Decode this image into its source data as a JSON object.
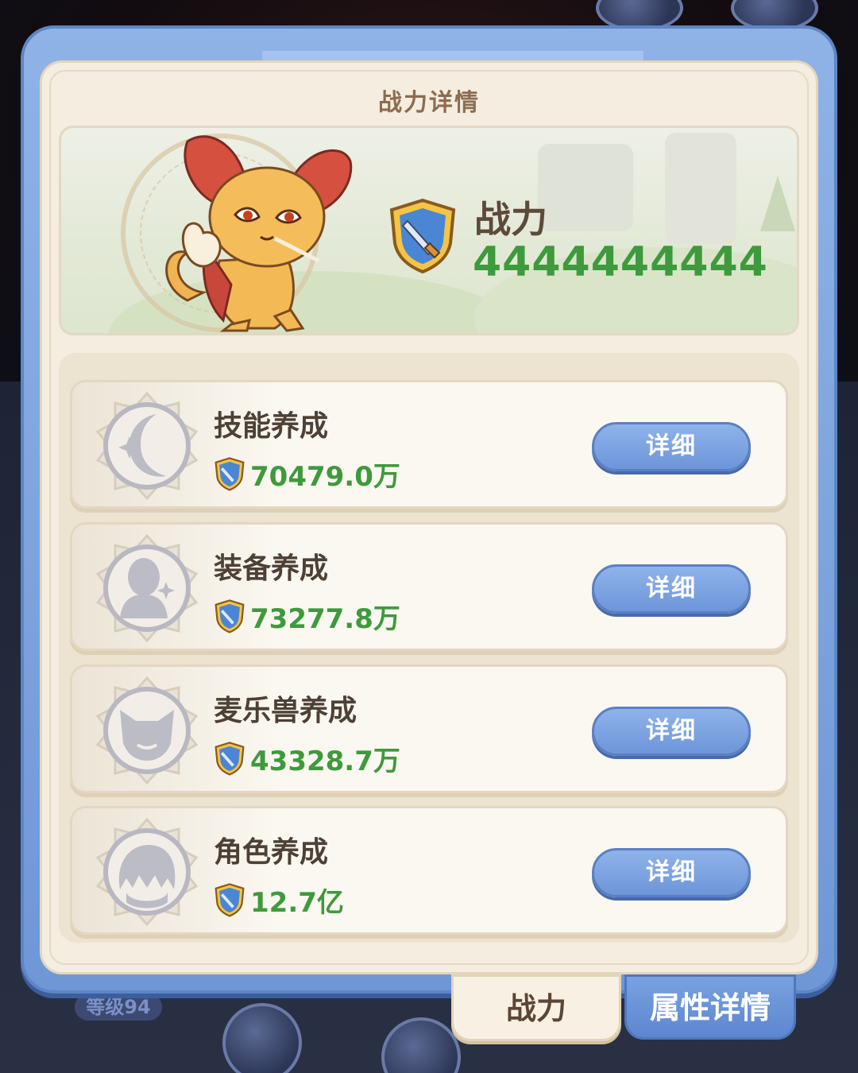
{
  "dialog": {
    "title": "战力详情"
  },
  "hero": {
    "power_label": "战力",
    "power_value": "4444444444"
  },
  "cards": [
    {
      "title": "技能养成",
      "value": "70479.0万",
      "button": "详细",
      "icon": "moon-star-icon"
    },
    {
      "title": "装备养成",
      "value": "73277.8万",
      "button": "详细",
      "icon": "figure-sparkle-icon"
    },
    {
      "title": "麦乐兽养成",
      "value": "43328.7万",
      "button": "详细",
      "icon": "cat-head-icon"
    },
    {
      "title": "角色养成",
      "value": "12.7亿",
      "button": "详细",
      "icon": "hair-head-icon"
    }
  ],
  "tabs": {
    "power": "战力",
    "attributes": "属性详情"
  },
  "background": {
    "level_badge": "等级94"
  },
  "colors": {
    "frame_blue": "#7da4e0",
    "panel_cream": "#f4ede0",
    "value_green": "#3e9a3c",
    "button_blue": "#7ea3e3"
  }
}
